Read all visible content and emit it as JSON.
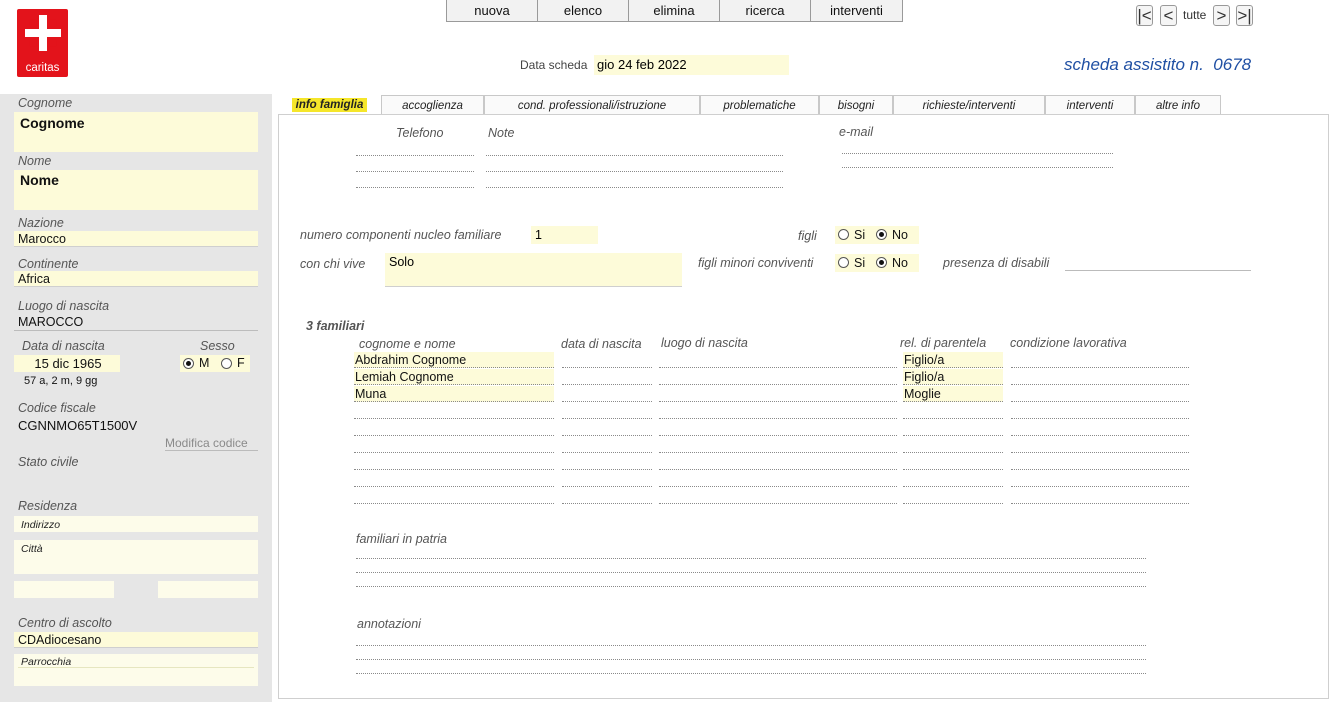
{
  "logo": {
    "text": "caritas"
  },
  "menu": [
    "nuova",
    "elenco",
    "elimina",
    "ricerca",
    "interventi"
  ],
  "nav": {
    "first": "|<",
    "prev": "<",
    "label": "tutte",
    "next": ">",
    "last": ">|"
  },
  "header": {
    "date_label": "Data scheda",
    "date_value": "gio 24 feb 2022",
    "record_title": "scheda assistito n.  0678"
  },
  "left": {
    "cognome_label": "Cognome",
    "cognome_value": "Cognome",
    "nome_label": "Nome",
    "nome_value": "Nome",
    "nazione_label": "Nazione",
    "nazione_value": "Marocco",
    "continente_label": "Continente",
    "continente_value": "Africa",
    "luogo_label": "Luogo di nascita",
    "luogo_value": "MAROCCO",
    "data_nascita_label": "Data di nascita",
    "data_nascita_value": "15 dic 1965",
    "eta": "57 a, 2 m, 9 gg",
    "sesso_label": "Sesso",
    "sesso_m": "M",
    "sesso_f": "F",
    "codice_label": "Codice fiscale",
    "codice_value": "CGNNMO65T1500V",
    "modifica_codice": "Modifica codice",
    "stato_civile_label": "Stato civile",
    "residenza_label": "Residenza",
    "indirizzo_placeholder": "Indirizzo",
    "citta_placeholder": "Città",
    "centro_label": "Centro di ascolto",
    "centro_value": "CDAdiocesano",
    "parrocchia_placeholder": "Parrocchia"
  },
  "tabs": [
    "info famiglia",
    "accoglienza",
    "cond. professionali/istruzione",
    "problematiche",
    "bisogni",
    "richieste/interventi",
    "interventi",
    "altre info"
  ],
  "main": {
    "telefono_label": "Telefono",
    "note_label": "Note",
    "email_label": "e-mail",
    "num_componenti_label": "numero componenti nucleo familiare",
    "num_componenti_value": "1",
    "figli_label": "figli",
    "si": "Si",
    "no": "No",
    "con_chi_vive_label": "con chi vive",
    "con_chi_vive_value": "Solo",
    "figli_minori_label": "figli minori conviventi",
    "disabili_label": "presenza di disabili",
    "familiari_count": "3 familiari",
    "col_nome": "cognome e nome",
    "col_data": "data di nascita",
    "col_luogo": "luogo di nascita",
    "col_rel": "rel. di parentela",
    "col_cond": "condizione lavorativa",
    "familiari": [
      {
        "nome": "Abdrahim Cognome",
        "rel": "Figlio/a"
      },
      {
        "nome": "Lemiah Cognome",
        "rel": "Figlio/a"
      },
      {
        "nome": "Muna",
        "rel": "Moglie"
      }
    ],
    "familiari_patria_label": "familiari in patria",
    "annotazioni_label": "annotazioni"
  }
}
